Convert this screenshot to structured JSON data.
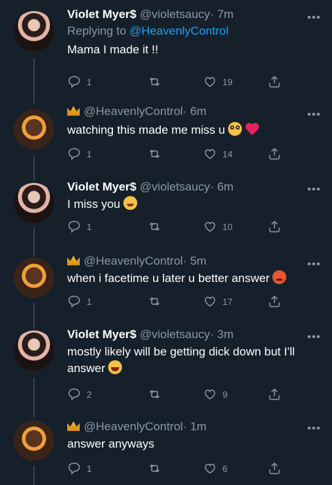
{
  "tweets": [
    {
      "name": "Violet Myer$",
      "handle": "@violetsaucy",
      "time": "· 7m",
      "reply_prefix": "Replying to",
      "reply_mention": "@HeavenlyControl",
      "text": "Mama I made it !!",
      "replies": "1",
      "likes": "19",
      "emoji": []
    },
    {
      "name": "",
      "handle": "@HeavenlyControl",
      "time": "· 6m",
      "text": "watching this made me miss u",
      "replies": "1",
      "likes": "14",
      "emoji": [
        "pleading-face",
        "red-heart"
      ]
    },
    {
      "name": "Violet Myer$",
      "handle": "@violetsaucy",
      "time": "· 6m",
      "text": "I miss you",
      "replies": "1",
      "likes": "10",
      "emoji": [
        "tired-face"
      ]
    },
    {
      "name": "",
      "handle": "@HeavenlyControl",
      "time": "· 5m",
      "text": "when i facetime u later u better answer",
      "replies": "1",
      "likes": "17",
      "emoji": [
        "angry-face"
      ]
    },
    {
      "name": "Violet Myer$",
      "handle": "@violetsaucy",
      "time": "· 3m",
      "text": "mostly likely will be getting dick down but I'll answer",
      "replies": "2",
      "likes": "9",
      "emoji": [
        "tears-of-joy"
      ]
    },
    {
      "name": "",
      "handle": "@HeavenlyControl",
      "time": "· 1m",
      "text": "answer anyways",
      "replies": "1",
      "likes": "6",
      "emoji": []
    }
  ],
  "icons": {
    "reply": "reply-icon",
    "retweet": "retweet-icon",
    "like": "like-icon",
    "share": "share-icon",
    "more": "more-icon",
    "crown": "crown-icon"
  }
}
